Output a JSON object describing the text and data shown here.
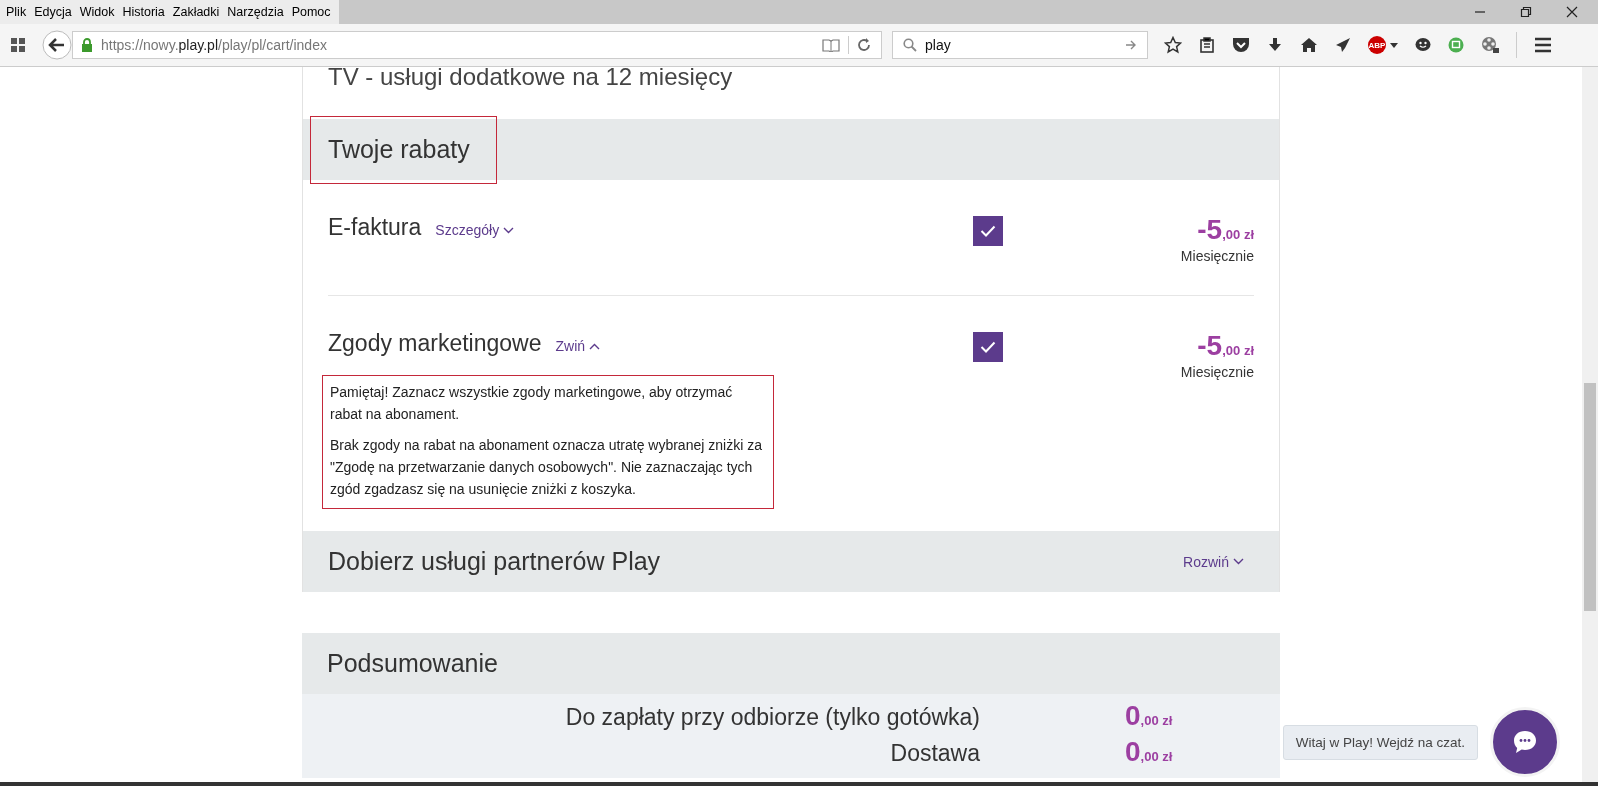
{
  "menu_bar": [
    "Plik",
    "Edycja",
    "Widok",
    "Historia",
    "Zakładki",
    "Narzędzia",
    "Pomoc"
  ],
  "toolbar": {
    "url_prefix": "https://nowy.",
    "url_domain": "play.pl",
    "url_path": "/play/pl/cart/index",
    "search_value": "play",
    "adblock_label": "ABP"
  },
  "page": {
    "top_heading": "TV - usługi dodatkowe na 12 miesięcy",
    "discounts": {
      "title": "Twoje rabaty",
      "highlighted": true,
      "items": [
        {
          "name": "E-faktura",
          "toggle": "Szczegóły",
          "expanded": false,
          "checked": true,
          "amount_main": "-5",
          "amount_fraction": ",00 zł",
          "period": "Miesięcznie"
        },
        {
          "name": "Zgody marketingowe",
          "toggle": "Zwiń",
          "expanded": true,
          "checked": true,
          "amount_main": "-5",
          "amount_fraction": ",00 zł",
          "period": "Miesięcznie",
          "note_highlighted": true,
          "note": [
            "Pamiętaj! Zaznacz wszystkie zgody marketingowe, aby otrzymać rabat na abonament.",
            "Brak zgody na rabat na abonament oznacza utratę wybranej zniżki za \"Zgodę na przetwarzanie danych osobowych\". Nie zaznaczając tych zgód zgadzasz się na usunięcie zniżki z koszyka."
          ]
        }
      ]
    },
    "partners": {
      "title": "Dobierz usługi partnerów Play",
      "toggle": "Rozwiń",
      "expanded": false
    },
    "summary": {
      "title": "Podsumowanie",
      "rows": [
        {
          "label": "Do zapłaty przy odbiorze (tylko gotówka)",
          "amount_main": "0",
          "amount_fraction": ",00 zł"
        },
        {
          "label": "Dostawa",
          "amount_main": "0",
          "amount_fraction": ",00 zł"
        }
      ]
    }
  },
  "chat": {
    "prompt": "Witaj w Play! Wejdź na czat."
  }
}
